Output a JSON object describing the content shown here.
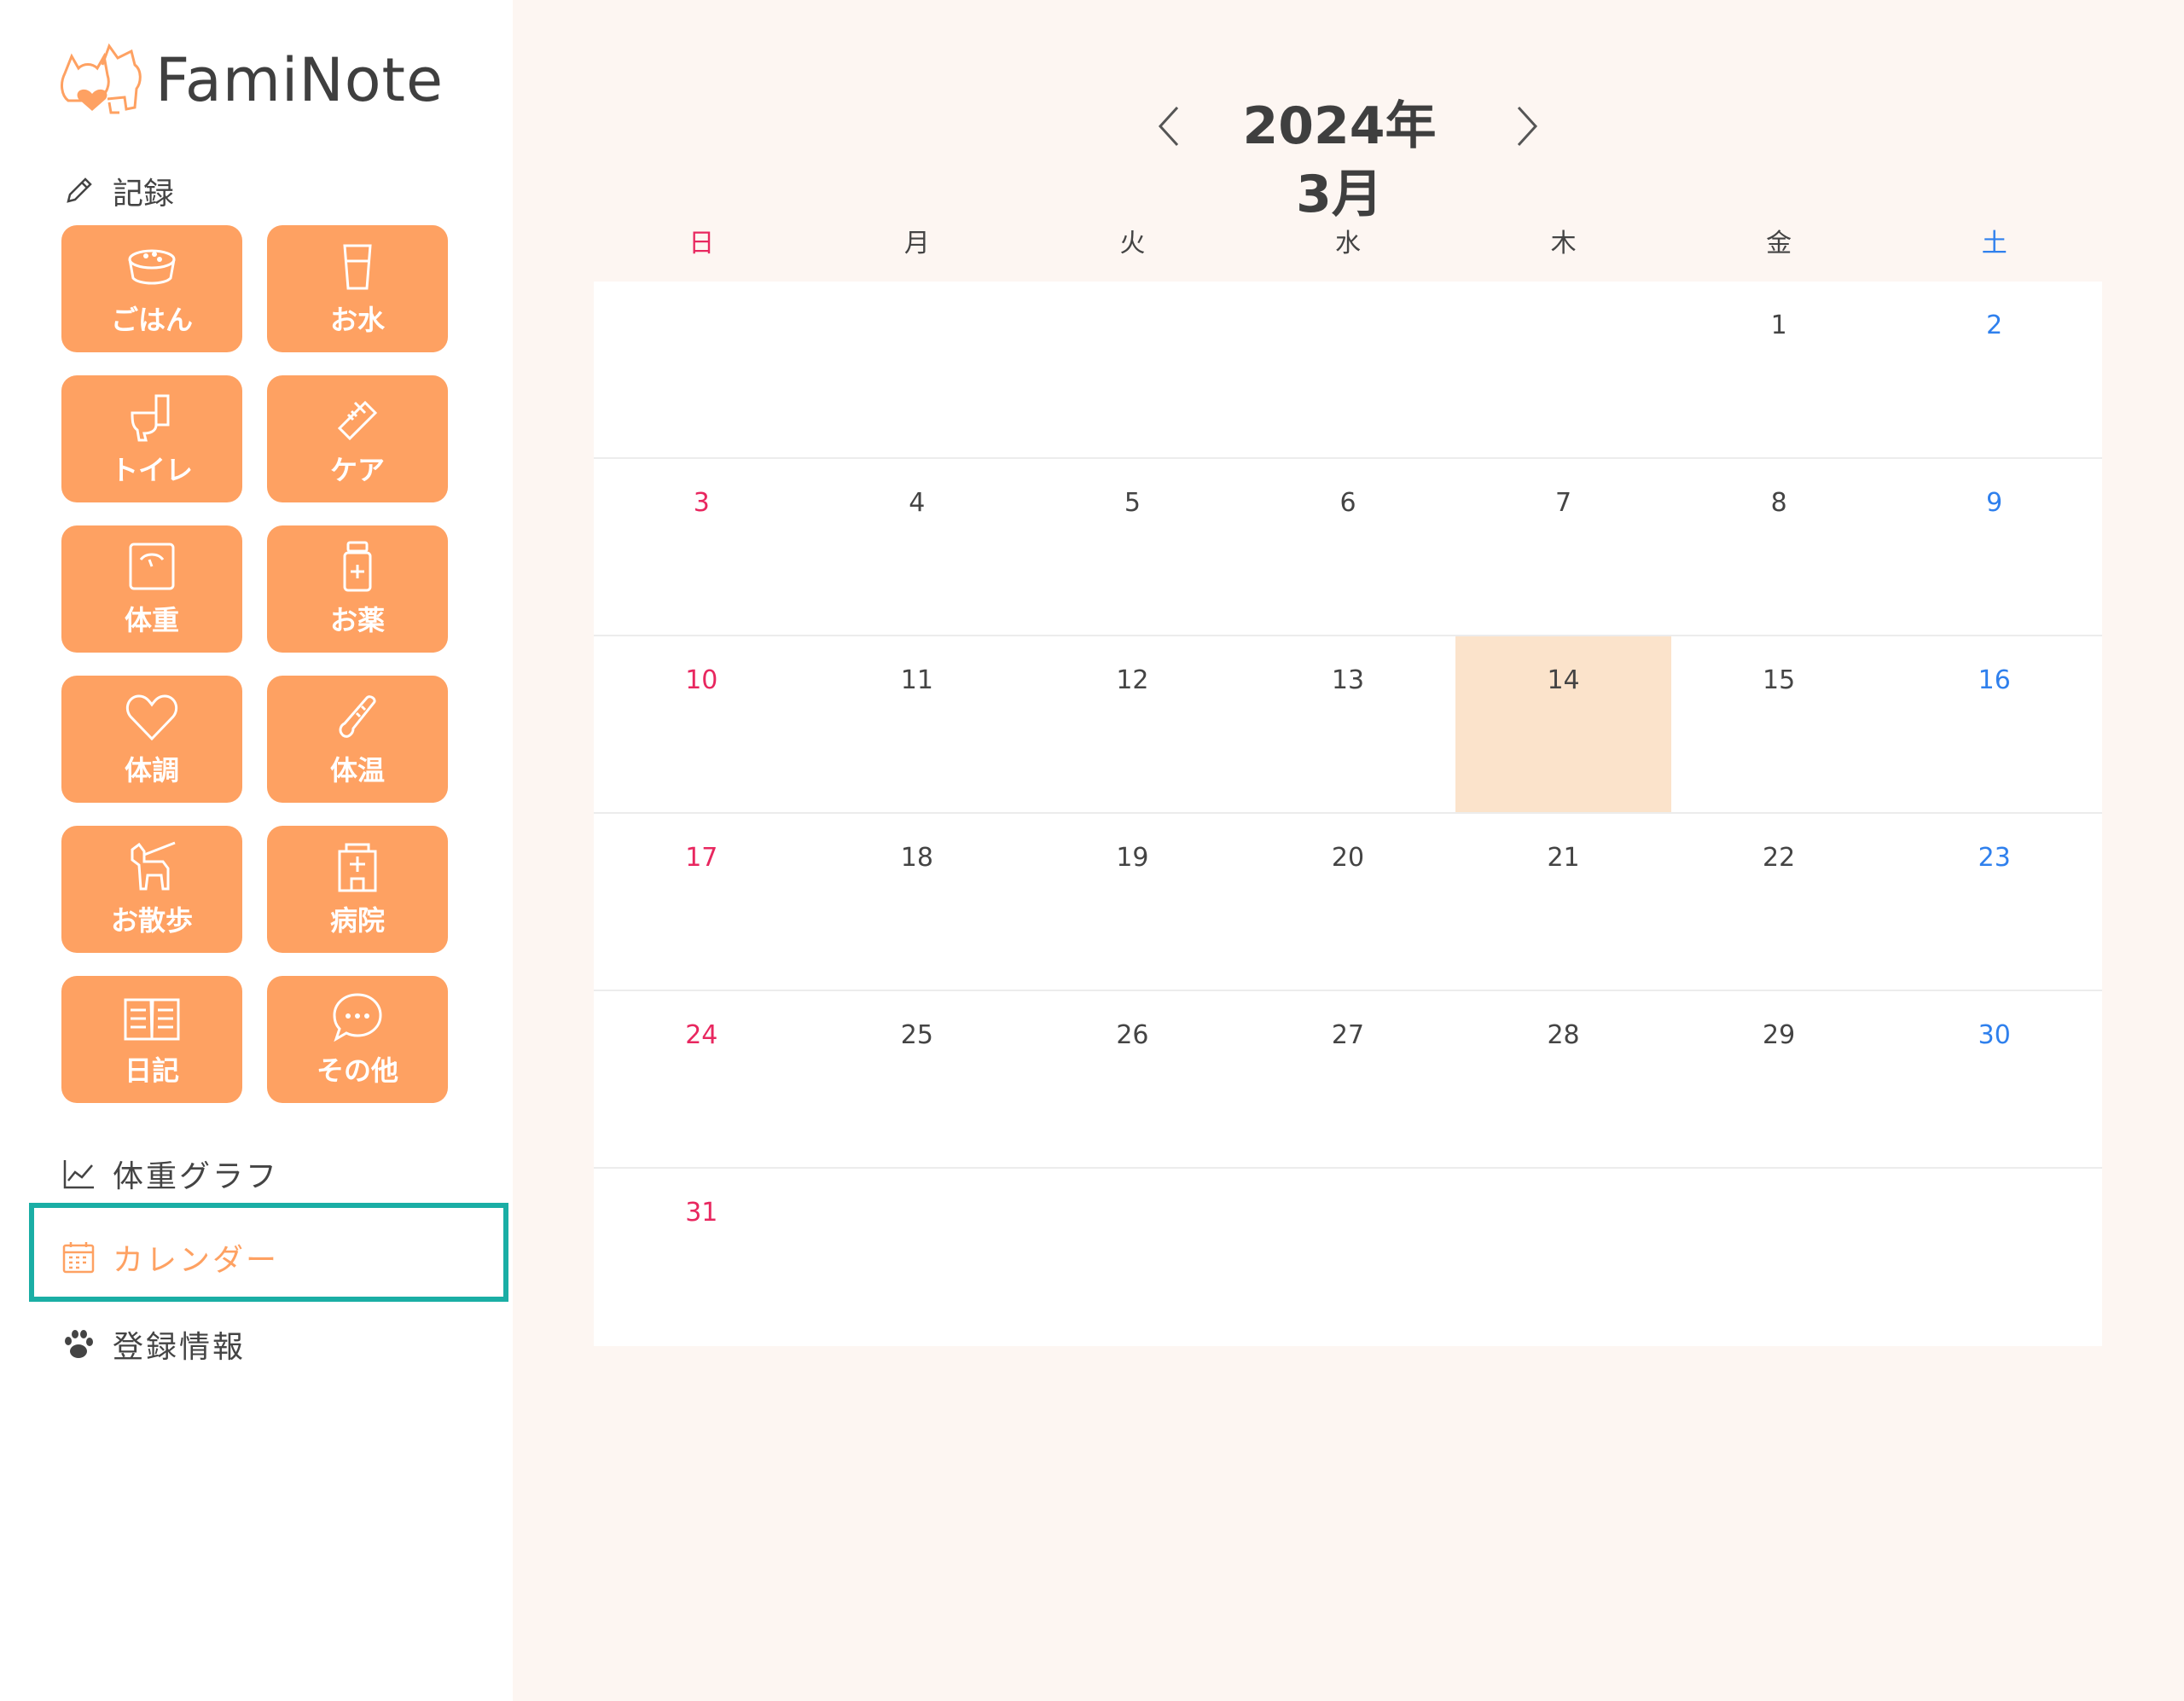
{
  "app": {
    "name": "FamiNote"
  },
  "sidebar": {
    "record_heading": "記録",
    "tiles": [
      {
        "label": "ごはん",
        "icon": "food-bowl-icon"
      },
      {
        "label": "お水",
        "icon": "water-cup-icon"
      },
      {
        "label": "トイレ",
        "icon": "toilet-icon"
      },
      {
        "label": "ケア",
        "icon": "comb-icon"
      },
      {
        "label": "体重",
        "icon": "scale-icon"
      },
      {
        "label": "お薬",
        "icon": "medicine-bottle-icon"
      },
      {
        "label": "体調",
        "icon": "heart-icon"
      },
      {
        "label": "体温",
        "icon": "thermometer-icon"
      },
      {
        "label": "お散歩",
        "icon": "dog-walk-icon"
      },
      {
        "label": "病院",
        "icon": "hospital-icon"
      },
      {
        "label": "日記",
        "icon": "book-icon"
      },
      {
        "label": "その他",
        "icon": "chat-bubble-icon"
      }
    ],
    "nav": {
      "weight_graph": "体重グラフ",
      "calendar": "カレンダー",
      "registration": "登録情報"
    }
  },
  "calendar": {
    "month_title": "2024年3月",
    "weekdays": [
      "日",
      "月",
      "火",
      "水",
      "木",
      "金",
      "土"
    ],
    "days": [
      "",
      "",
      "",
      "",
      "",
      "1",
      "2",
      "3",
      "4",
      "5",
      "6",
      "7",
      "8",
      "9",
      "10",
      "11",
      "12",
      "13",
      "14",
      "15",
      "16",
      "17",
      "18",
      "19",
      "20",
      "21",
      "22",
      "23",
      "24",
      "25",
      "26",
      "27",
      "28",
      "29",
      "30",
      "31",
      "",
      "",
      "",
      "",
      "",
      ""
    ],
    "today": "14"
  },
  "colors": {
    "accent": "#fea162",
    "sunday": "#e8275f",
    "saturday": "#2f80ed",
    "today_bg": "#fbe3cb",
    "highlight_border": "#1aaea5",
    "page_bg": "#fdf6f2"
  }
}
